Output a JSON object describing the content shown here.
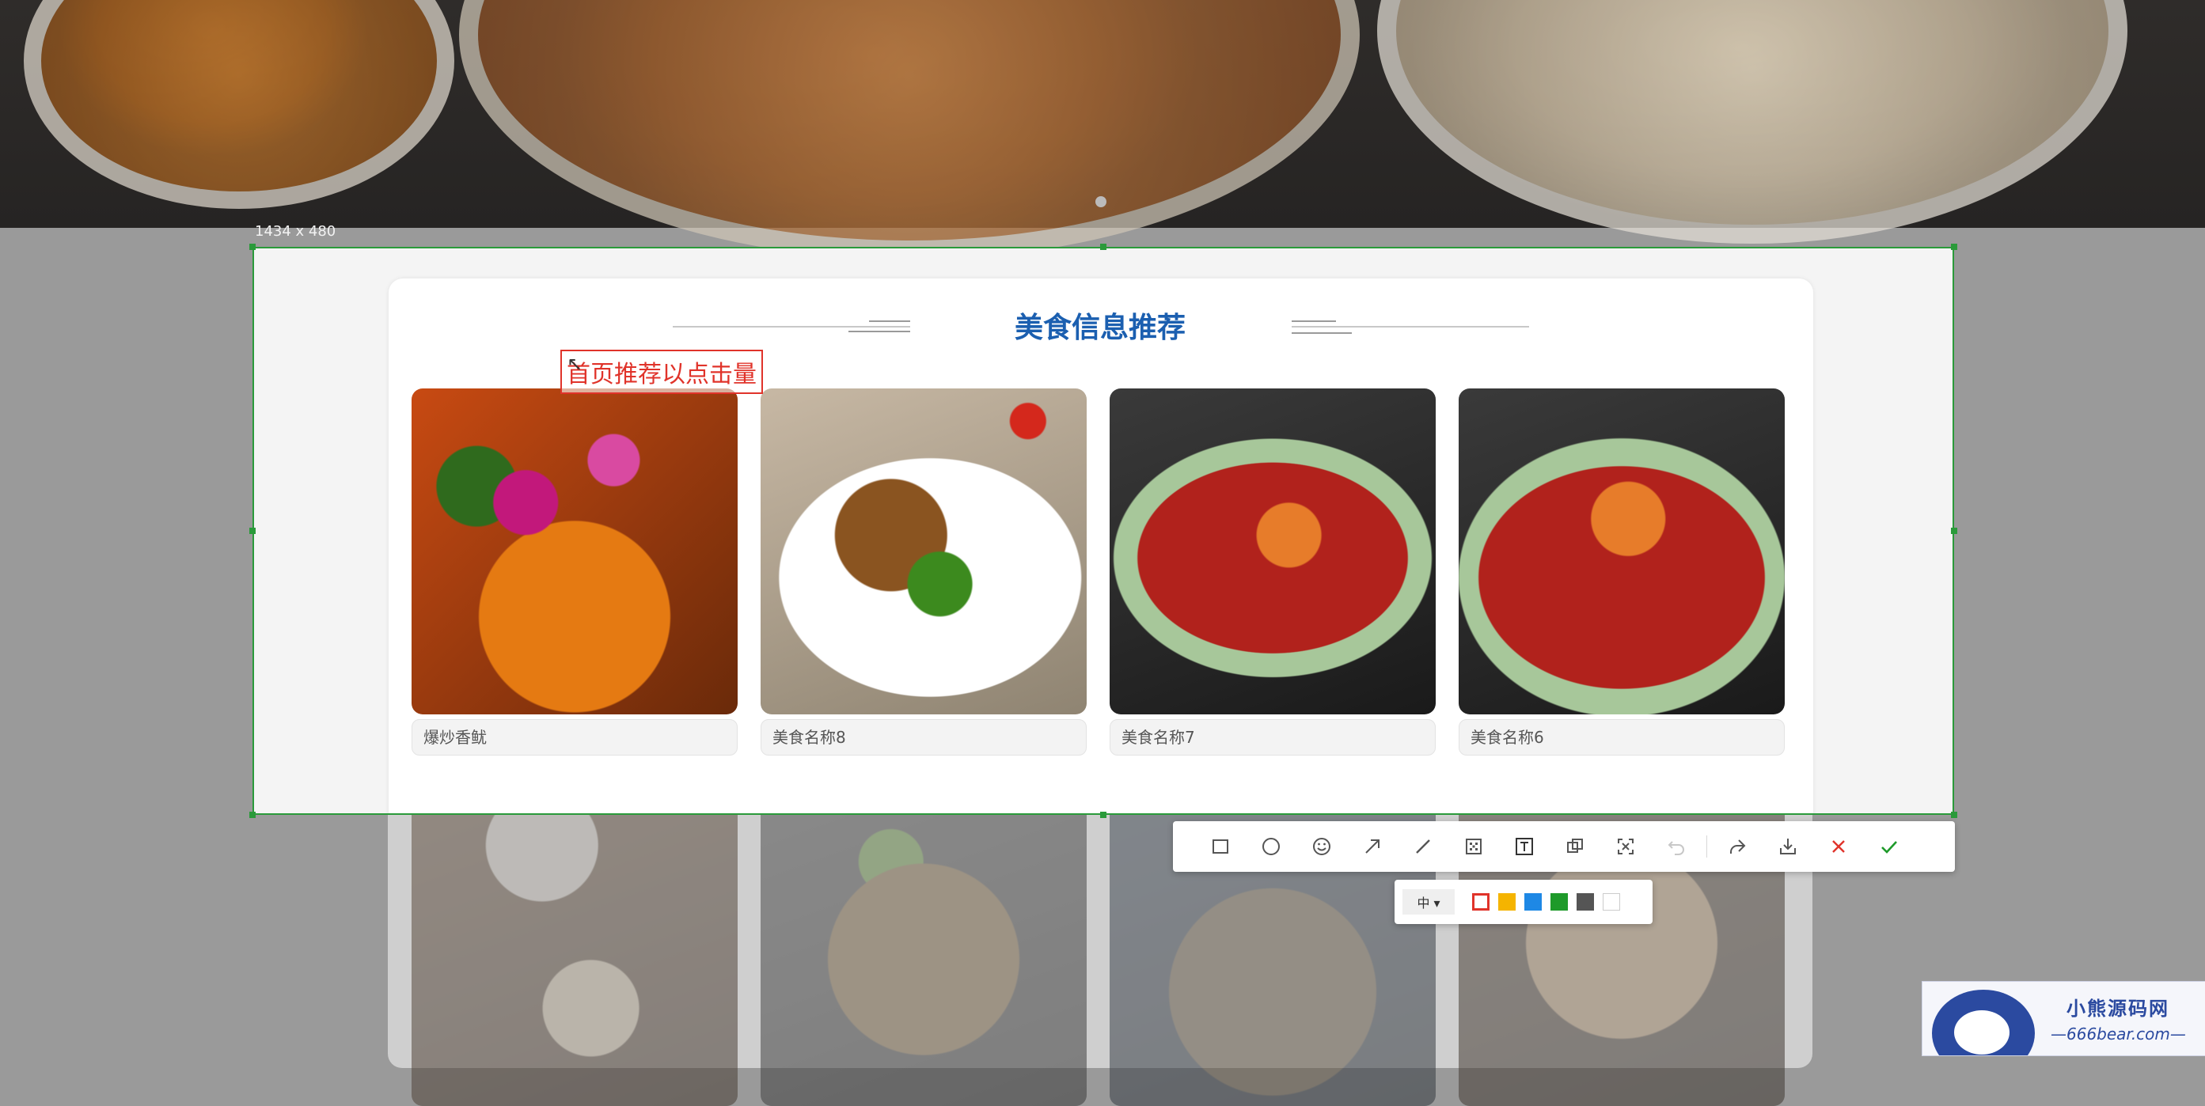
{
  "selection": {
    "size_label": "1434 x 480"
  },
  "section": {
    "title": "美食信息推荐"
  },
  "annotation": {
    "text": "首页推荐以点击量"
  },
  "foods": [
    {
      "name": "爆炒香鱿"
    },
    {
      "name": "美食名称8"
    },
    {
      "name": "美食名称7"
    },
    {
      "name": "美食名称6"
    }
  ],
  "toolbar": {
    "tools": [
      "rectangle-icon",
      "ellipse-icon",
      "emoji-icon",
      "arrow-icon",
      "pen-icon",
      "mosaic-icon",
      "text-icon",
      "pin-icon",
      "ocr-icon",
      "undo-icon",
      "share-icon",
      "download-icon",
      "cancel-icon",
      "confirm-icon"
    ],
    "active_tool": "text-icon"
  },
  "subbar": {
    "font_size": "中 ▾",
    "colors": [
      "#e0332a",
      "#f5b400",
      "#1e88e5",
      "#1e9a2a",
      "#555555",
      "#ffffff"
    ],
    "selected_color": "#e0332a"
  },
  "watermark": {
    "brand": "小熊源码网",
    "url": "—666bear.com—"
  },
  "colors": {
    "selection_border": "#2a9a3a",
    "title": "#1b5fb0",
    "annotation": "#e0332a"
  }
}
